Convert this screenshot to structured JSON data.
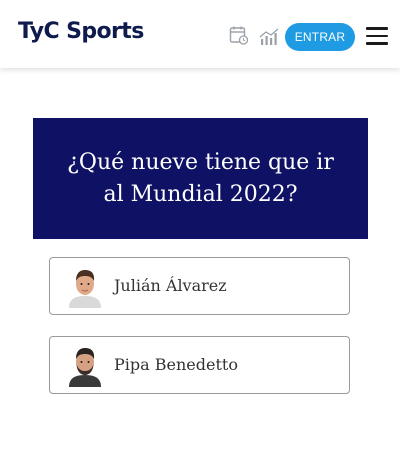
{
  "header": {
    "logo_text": "TyC Sports",
    "icons": [
      "calendar-icon",
      "stats-chart-icon",
      "hamburger-menu-icon"
    ],
    "enter_label": "ENTRAR"
  },
  "poll": {
    "question": "¿Qué nueve tiene que ir al Mundial 2022?",
    "options": [
      {
        "label": "Julián Álvarez",
        "avatar": "player-avatar-icon"
      },
      {
        "label": "Pipa Benedetto",
        "avatar": "player-avatar-icon"
      }
    ]
  },
  "colors": {
    "brand_navy": "#0f1264",
    "logo_navy": "#0f1a4d",
    "accent_blue": "#1f9be3"
  }
}
